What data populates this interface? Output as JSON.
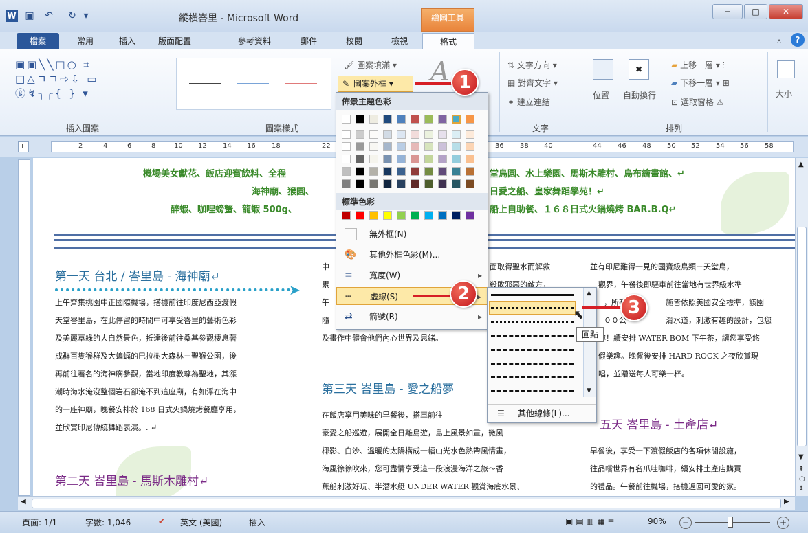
{
  "window": {
    "title": "縱橫峇里 - Microsoft Word",
    "contextual_tab": "繪圖工具",
    "min": "─",
    "max": "□",
    "close": "✕"
  },
  "tabs": [
    "檔案",
    "常用",
    "插入",
    "版面配置",
    "參考資料",
    "郵件",
    "校閱",
    "檢視",
    "格式"
  ],
  "ribbon": {
    "shape_fill": "圖案填滿",
    "shape_outline": "圖案外框",
    "insert_shapes_label": "插入圖案",
    "shape_styles_label": "圖案樣式",
    "text_direction": "文字方向",
    "align_text": "對齊文字",
    "create_link": "建立連結",
    "text_label": "文字",
    "position": "位置",
    "wrap_text": "自動換行",
    "bring_forward": "上移一層",
    "send_backward": "下移一層",
    "selection_pane": "選取窗格",
    "arrange_label": "排列",
    "size": "大小"
  },
  "ruler": [
    "2",
    "4",
    "6",
    "8",
    "10",
    "12",
    "14",
    "16",
    "18",
    "22",
    "36",
    "38",
    "40",
    "44",
    "46",
    "48",
    "50",
    "52",
    "54",
    "56",
    "58"
  ],
  "dropdown": {
    "theme_colors": "佈景主題色彩",
    "standard_colors": "標準色彩",
    "no_outline": "無外框(N)",
    "more_colors": "其他外框色彩(M)...",
    "weight": "寬度(W)",
    "dashes": "虛線(S)",
    "arrows": "箭號(R)"
  },
  "submenu": {
    "more_lines": "其他線條(L)...",
    "tooltip": "圓點"
  },
  "callouts": [
    "1",
    "2",
    "3"
  ],
  "colors": {
    "theme_top": [
      "#ffffff",
      "#000000",
      "#eeece1",
      "#1f497d",
      "#4f81bd",
      "#c0504d",
      "#9bbb59",
      "#8064a2",
      "#4bacc6",
      "#f79646"
    ],
    "standard": [
      "#c00000",
      "#ff0000",
      "#ffc000",
      "#ffff00",
      "#92d050",
      "#00b050",
      "#00b0f0",
      "#0070c0",
      "#002060",
      "#7030a0"
    ]
  },
  "document": {
    "banner1": "機場美女獻花、飯店迎賓飲料、全程",
    "banner1b": "堂鳥園、水上樂園、馬斯木雕村、鳥布繪畫館、↵",
    "banner2": "海神廟、猴園、",
    "banner2b": "日愛之船、皇家舞蹈學苑！↵",
    "banner3": "醉蝦、咖哩螃蟹、龍蝦 500g、",
    "banner3b": "船上自助餐、１６８日式火鍋燒烤 BAR.B.Q↵",
    "day1": "第一天 台北 / 峇里島 - 海神廟↵",
    "day1_lines": [
      "上午齊集桃園中正國際機場，搭機前往印度尼西亞渡假",
      "天堂峇里島，在此停留的時間中可享受峇里的藝術色彩",
      "及美麗草綠的大自然景色，抵達後前往桑基參觀棲息著",
      "成群百隻猴群及大蝙蝠的巴拉樹大森林－聖猴公園，後",
      "再前往著名的海神廟參觀，當地印度教尊為聖地，其漲",
      "潮時海水淹沒整個岩石卻淹不到這座廟，有如浮在海中",
      "的一座神廟，晚餐安排於 168 日式火鍋燒烤餐廳享用，",
      "並欣賞印尼傳統舞蹈表演。. ↵"
    ],
    "day2": "第二天 峇里島 - 馬斯木雕村↵",
    "col2_top": [
      "中",
      "累",
      "午",
      "隨",
      "及畫作中體會他們內心世界及思緒。"
    ],
    "col2b_right": [
      "面取得聖水而解救",
      "殺敗邪惡的敵方，",
      "",
      "",
      ""
    ],
    "day3": "第三天 峇里島 - 愛之船夢",
    "day3_lines": [
      "在飯店享用美味的早餐後，搭車前往",
      "豪愛之船巡遊，展開全日離島遊，島上風景如畫，微風",
      "椰影、白沙、溫暖的太陽構成一幅山光水色熱帶風情畫，",
      "海風徐徐吹來，您可盡情享受這一段浪漫海洋之旅～香",
      "蕉船刺激好玩、半潛水艇 UNDER WATER 觀賞海底水景、"
    ],
    "col3_lines": [
      "並有印尼難得一見的國寶級鳥類－天堂鳥，",
      "觀界，午餐後即驅車前往當地有世界級水準",
      "，所有",
      "施皆依照美國安全標準，該園",
      "００公",
      "滑水道，刺激有趣的設計，包您",
      "趣！續安排 WATER BOM 下午茶，讓您享受悠",
      "假樂趣。晚餐後安排 HARD ROCK 之夜欣賞現",
      "唱，並贈送每人可樂一杯。"
    ],
    "day5": "五天 峇里島 - 土產店↵",
    "day5_lines": [
      "早餐後，享受一下渡假飯店的各項休閒設施，",
      "往品嚐世界有名爪哇咖啡，續安排土產店購買",
      "的禮品。午餐前往機場，搭機返回可愛的家。"
    ]
  },
  "status": {
    "page": "頁面: 1/1",
    "words": "字數: 1,046",
    "lang": "英文 (美國)",
    "mode": "插入",
    "zoom": "90%"
  }
}
